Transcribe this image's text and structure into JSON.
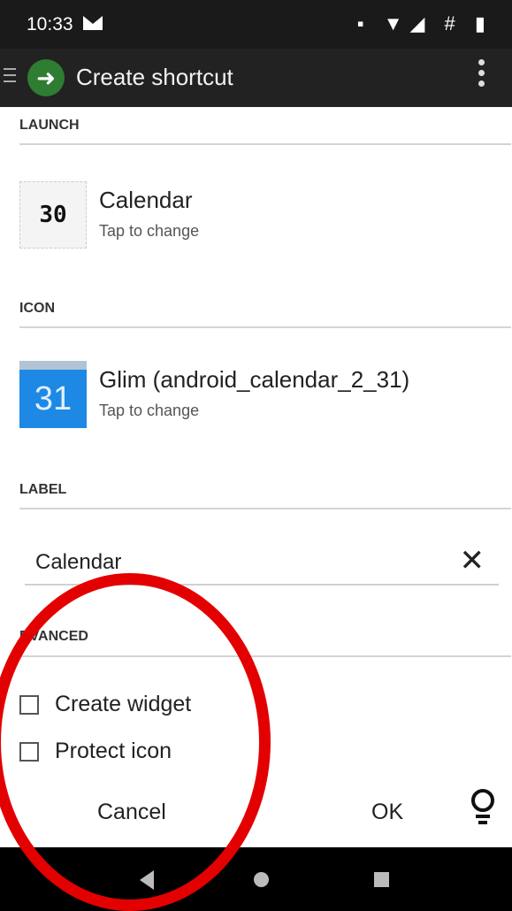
{
  "status_bar": {
    "time": "10:33",
    "icons": "▪ ▼◢ # ▮"
  },
  "app_bar": {
    "title": "Create shortcut",
    "logo": "➜"
  },
  "sections": {
    "launch": "LAUNCH",
    "icon": "ICON",
    "label": "LABEL",
    "advanced": "DVANCED"
  },
  "launch_item": {
    "title": "Calendar",
    "subtitle": "Tap to change",
    "icon_text": "30"
  },
  "icon_item": {
    "title": "Glim (android_calendar_2_31)",
    "subtitle": "Tap to change",
    "icon_text": "31"
  },
  "label_field": {
    "value": "Calendar",
    "clear_symbol": "✕"
  },
  "options": [
    {
      "label": "Create widget",
      "checked": false
    },
    {
      "label": "Protect icon",
      "checked": false
    }
  ],
  "buttons": {
    "cancel": "Cancel",
    "ok": "OK"
  },
  "colors": {
    "app_bar": "#222222",
    "status_bar": "#1a1a1a",
    "annotation": "#e30000",
    "logo": "#2e7d32"
  }
}
